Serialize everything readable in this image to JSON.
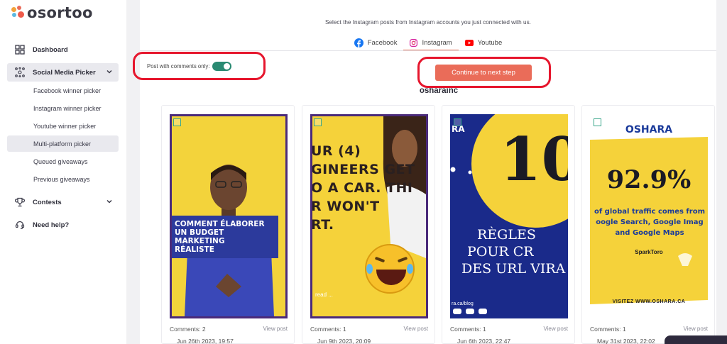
{
  "brand": {
    "name": "osortoo"
  },
  "sidebar": {
    "items": [
      {
        "label": "Dashboard",
        "icon": "dashboard-icon"
      },
      {
        "label": "Social Media Picker",
        "icon": "network-icon"
      },
      {
        "label": "Contests",
        "icon": "trophy-icon"
      },
      {
        "label": "Need help?",
        "icon": "help-icon"
      }
    ],
    "subitems": [
      {
        "label": "Facebook winner picker"
      },
      {
        "label": "Instagram winner picker"
      },
      {
        "label": "Youtube winner picker"
      },
      {
        "label": "Multi-platform picker"
      },
      {
        "label": "Queued giveaways"
      },
      {
        "label": "Previous giveaways"
      }
    ]
  },
  "main": {
    "instruction": "Select the Instagram posts from Instagram accounts you just connected with us.",
    "tabs": [
      {
        "label": "Facebook",
        "color": "#1877f2"
      },
      {
        "label": "Instagram",
        "color": "#d6249f"
      },
      {
        "label": "Youtube",
        "color": "#ff0000"
      }
    ],
    "filter_label": "Post with comments only:",
    "continue_label": "Continue to next step",
    "account": "osharainc",
    "posts": [
      {
        "comments": "Comments: 2",
        "view": "View post",
        "date": "Jun 26th 2023, 19:57",
        "overlay": [
          "COMMENT ÉLABORER",
          "UN BUDGET MARKETING",
          "RÉALISTE"
        ]
      },
      {
        "comments": "Comments: 1",
        "view": "View post",
        "date": "Jun 9th 2023, 20:09",
        "overlay": [
          "UR (4)",
          "GINEERS GET",
          "O A CAR. THI",
          "R WON'T",
          "RT."
        ],
        "caption": "read ..."
      },
      {
        "comments": "Comments: 1",
        "view": "View post",
        "date": "Jun 6th 2023, 22:47",
        "overlay": [
          "RA",
          "10",
          "RÈGLES",
          "POUR CR",
          "DES URL VIRA"
        ],
        "caption": "ra.ca/blog"
      },
      {
        "comments": "Comments: 1",
        "view": "View post",
        "date": "May 31st 2023, 22:02",
        "overlay": [
          "OSHARA",
          "92.9%",
          "of global traffic comes from",
          "oogle Search, Google Imag",
          "and Google Maps",
          "SparkToro",
          "VISITEZ WWW.OSHARA.CA"
        ]
      }
    ]
  },
  "colors": {
    "accent": "#ea6c59",
    "toggle": "#2a8a72",
    "highlight": "#e6162d"
  }
}
